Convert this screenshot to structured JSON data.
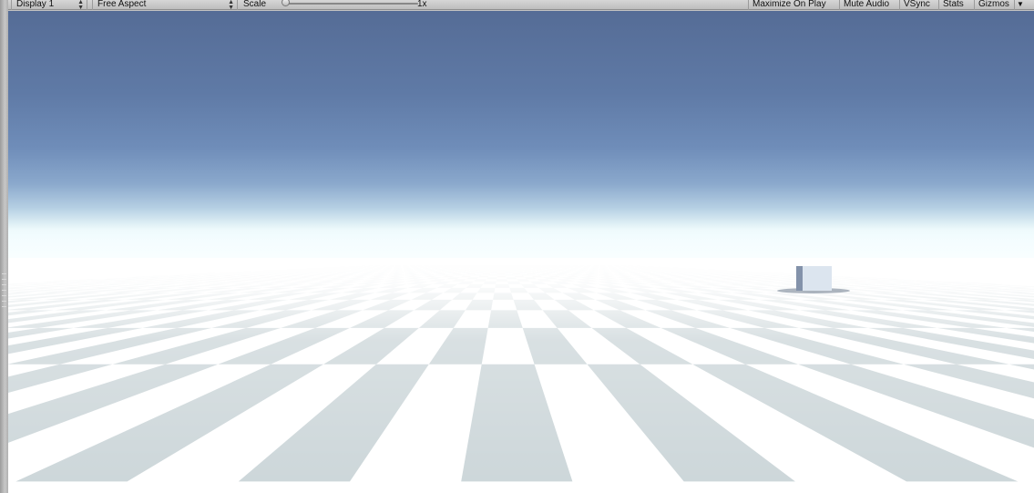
{
  "toolbar": {
    "display_label": "Display 1",
    "aspect_label": "Free Aspect",
    "scale_label": "Scale",
    "scale_value": "1x",
    "scale_fraction": 0.0,
    "maximize_on_play": "Maximize On Play",
    "mute_audio": "Mute Audio",
    "vsync": "VSync",
    "stats": "Stats",
    "gizmos": "Gizmos"
  },
  "scene": {
    "sky_top_color": "#556c96",
    "horizon_color": "#eefafc",
    "tile_light_color": "#ffffff",
    "tile_dark_color": "#ccd6d9"
  },
  "icons": [
    "dropdown-arrow-icon",
    "dropdown-arrow-icon",
    "gizmos-dropdown-arrow-icon"
  ]
}
